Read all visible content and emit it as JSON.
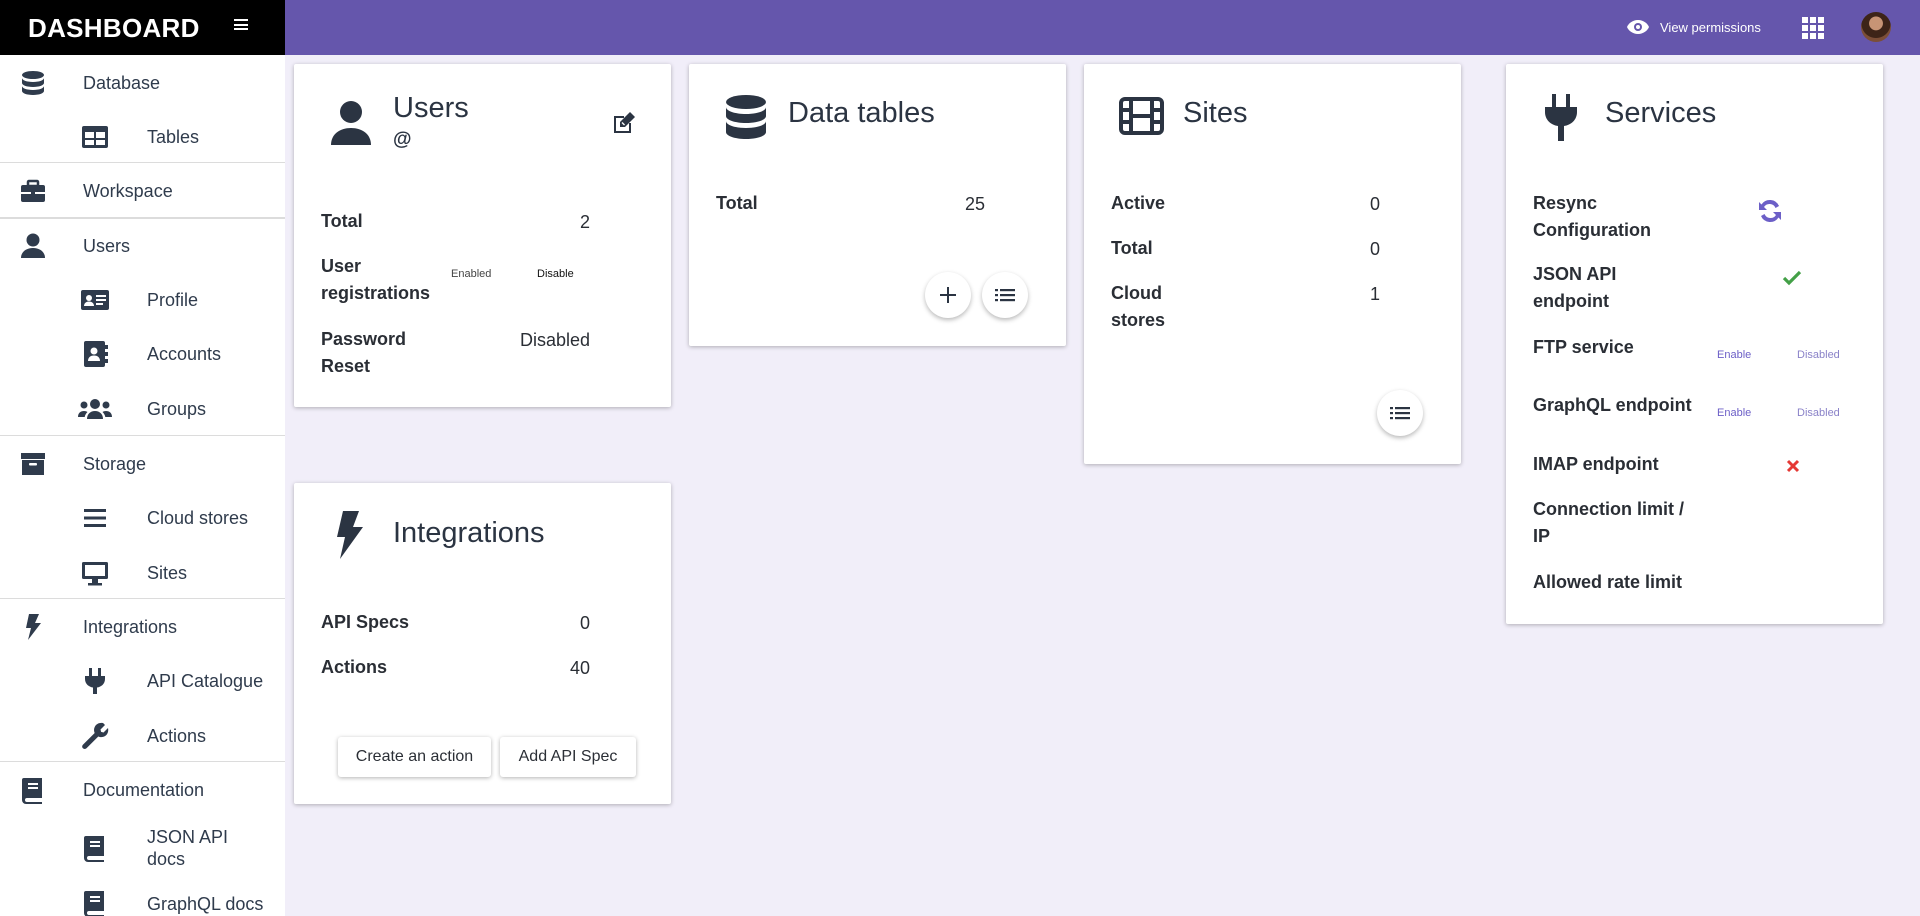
{
  "header": {
    "brand": "DASHBOARD",
    "view_permissions": "View permissions"
  },
  "sidebar": {
    "items": [
      {
        "label": "Database",
        "icon": "database-icon"
      },
      {
        "label": "Tables",
        "icon": "table-icon"
      },
      {
        "label": "Workspace",
        "icon": "briefcase-icon"
      },
      {
        "label": "Users",
        "icon": "user-icon"
      },
      {
        "label": "Profile",
        "icon": "id-card-icon"
      },
      {
        "label": "Accounts",
        "icon": "address-book-icon"
      },
      {
        "label": "Groups",
        "icon": "users-icon"
      },
      {
        "label": "Storage",
        "icon": "archive-icon"
      },
      {
        "label": "Cloud stores",
        "icon": "list-icon"
      },
      {
        "label": "Sites",
        "icon": "desktop-icon"
      },
      {
        "label": "Integrations",
        "icon": "bolt-icon"
      },
      {
        "label": "API Catalogue",
        "icon": "plug-icon"
      },
      {
        "label": "Actions",
        "icon": "wrench-icon"
      },
      {
        "label": "Documentation",
        "icon": "book-icon"
      },
      {
        "label": "JSON API docs",
        "icon": "book-icon"
      },
      {
        "label": "GraphQL docs",
        "icon": "book-icon"
      }
    ]
  },
  "users_card": {
    "title": "Users",
    "subtitle": "@",
    "total_label": "Total",
    "total_value": "2",
    "registrations_label": "User registrations",
    "registrations_enabled": "Enabled",
    "registrations_disable": "Disable",
    "password_label": "Password Reset",
    "password_value": "Disabled"
  },
  "data_tables_card": {
    "title": "Data tables",
    "total_label": "Total",
    "total_value": "25"
  },
  "sites_card": {
    "title": "Sites",
    "active_label": "Active",
    "active_value": "0",
    "total_label": "Total",
    "total_value": "0",
    "cloud_label": "Cloud stores",
    "cloud_value": "1"
  },
  "services_card": {
    "title": "Services",
    "resync_label": "Resync Configuration",
    "json_label": "JSON API endpoint",
    "ftp_label": "FTP service",
    "ftp_enable": "Enable",
    "ftp_status": "Disabled",
    "graphql_label": "GraphQL endpoint",
    "graphql_enable": "Enable",
    "graphql_status": "Disabled",
    "imap_label": "IMAP endpoint",
    "conn_label": "Connection limit / IP",
    "rate_label": "Allowed rate limit"
  },
  "integrations_card": {
    "title": "Integrations",
    "specs_label": "API Specs",
    "specs_value": "0",
    "actions_label": "Actions",
    "actions_value": "40",
    "create_button": "Create an action",
    "add_button": "Add API Spec"
  },
  "colors": {
    "topbar": "#6556ac",
    "accent": "#6c5fc7",
    "success": "#43a047",
    "danger": "#e53935"
  }
}
